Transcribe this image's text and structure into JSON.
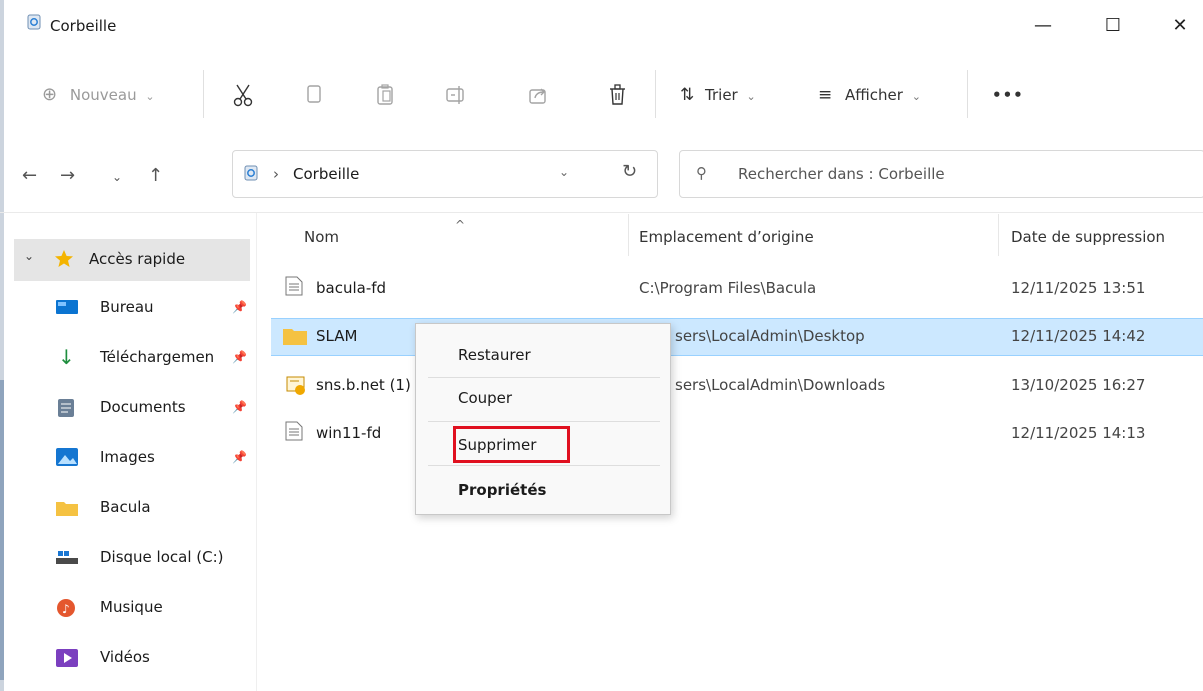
{
  "window": {
    "title": "Corbeille",
    "minimize": "—",
    "maximize": "☐",
    "close": "✕"
  },
  "toolbar": {
    "new_label": "Nouveau",
    "sort_label": "Trier",
    "view_label": "Afficher",
    "more_label": "•••"
  },
  "address": {
    "path": "Corbeille",
    "search_placeholder": "Rechercher dans : Corbeille"
  },
  "sidebar": {
    "quick_access": "Accès rapide",
    "items": [
      {
        "label": "Bureau",
        "pinned": true,
        "icon": "desktop-icon"
      },
      {
        "label": "Téléchargemen",
        "pinned": true,
        "icon": "download-icon"
      },
      {
        "label": "Documents",
        "pinned": true,
        "icon": "documents-icon"
      },
      {
        "label": "Images",
        "pinned": true,
        "icon": "images-icon"
      },
      {
        "label": "Bacula",
        "pinned": false,
        "icon": "folder-icon"
      },
      {
        "label": "Disque local (C:)",
        "pinned": false,
        "icon": "drive-icon"
      },
      {
        "label": "Musique",
        "pinned": false,
        "icon": "music-icon"
      },
      {
        "label": "Vidéos",
        "pinned": false,
        "icon": "videos-icon"
      }
    ]
  },
  "columns": {
    "name": "Nom",
    "origin": "Emplacement d’origine",
    "deleted": "Date de suppression"
  },
  "files": [
    {
      "name": "bacula-fd",
      "origin": "C:\\Program Files\\Bacula",
      "date": "12/11/2025 13:51",
      "icon": "file-icon"
    },
    {
      "name": "SLAM",
      "origin": "sers\\LocalAdmin\\Desktop",
      "date": "12/11/2025 14:42",
      "icon": "folder-icon",
      "selected": true
    },
    {
      "name": "sns.b.net (1)",
      "origin": "sers\\LocalAdmin\\Downloads",
      "date": "13/10/2025 16:27",
      "icon": "certificate-icon"
    },
    {
      "name": "win11-fd",
      "origin": "",
      "date": "12/11/2025 14:13",
      "icon": "file-icon"
    }
  ],
  "context_menu": {
    "restore": "Restaurer",
    "cut": "Couper",
    "delete": "Supprimer",
    "properties": "Propriétés"
  },
  "colors": {
    "selection": "#cce8ff",
    "highlight_box": "#e0101f",
    "folder": "#f5c242"
  }
}
